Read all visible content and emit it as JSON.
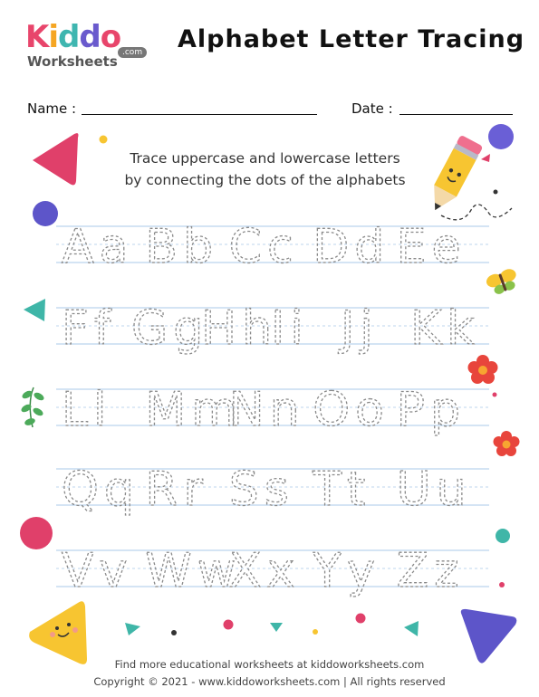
{
  "logo": {
    "letters": [
      "K",
      "i",
      "d",
      "d",
      "o"
    ],
    "letter_colors": [
      "#e8456b",
      "#f5a623",
      "#3fb6b0",
      "#6a5acd",
      "#e8456b"
    ],
    "subtitle": "Worksheets",
    "badge": ".com"
  },
  "title": "Alphabet Letter Tracing",
  "name_label": "Name :",
  "date_label": "Date :",
  "instructions": {
    "line1": "Trace uppercase and lowercase letters",
    "line2": "by connecting the dots of the alphabets"
  },
  "tracing_rows": [
    [
      "Aa",
      "Bb",
      "Cc",
      "Dd",
      "Ee"
    ],
    [
      "Ff",
      "Gg",
      "Hh",
      "Ii",
      "Jj",
      "Kk"
    ],
    [
      "Ll",
      "Mm",
      "Nn",
      "Oo",
      "Pp"
    ],
    [
      "Qq",
      "Rr",
      "Ss",
      "Tt",
      "Uu"
    ],
    [
      "Vv",
      "Ww",
      "Xx",
      "Yy",
      "Zz"
    ]
  ],
  "colors": {
    "guide_line": "#a9c8e8",
    "trace_text": "#8a8a8a",
    "pink": "#e0406a",
    "purple": "#6a5fd6",
    "teal": "#3fb6a8",
    "yellow": "#f7c531"
  },
  "footer": {
    "line1": "Find more educational worksheets at kiddoworksheets.com",
    "line2": "Copyright © 2021 - www.kiddoworksheets.com  |  All rights reserved"
  }
}
